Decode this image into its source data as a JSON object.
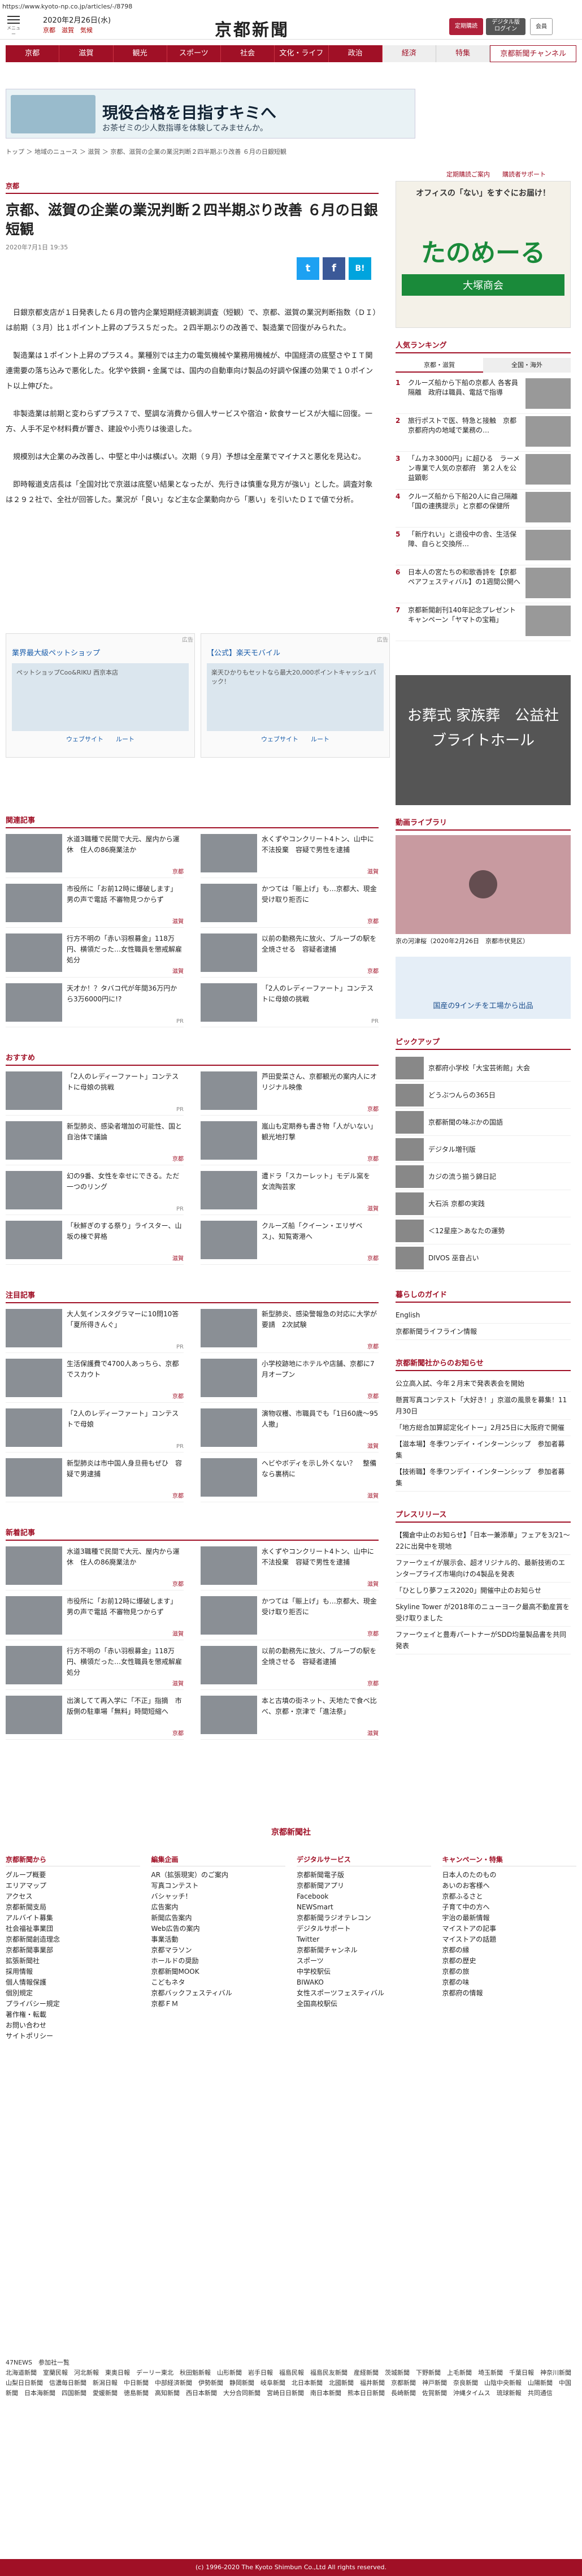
{
  "url": "https://www.kyoto-np.co.jp/articles/-/8798",
  "header": {
    "menu": "メニュー",
    "date": "2020年2月26日(水)",
    "weather_cities": "京都　滋賀　気候",
    "logo": "京都新聞",
    "btn_login": "定期購読",
    "btn_member": "デジタル版\nログイン",
    "btn_mypage": "会員"
  },
  "nav": [
    "京都",
    "滋賀",
    "観光",
    "スポーツ",
    "社会",
    "文化・ライフ",
    "政治",
    "経済",
    "特集",
    "京都新聞チャンネル"
  ],
  "banner": {
    "title": "現役合格を目指すキミへ",
    "sub": "お茶ゼミの少人数指導を体験してみませんか。"
  },
  "breadcrumb": "トップ ＞ 地域のニュース ＞ 滋賀 ＞ 京都、滋賀の企業の業況判断２四半期ぶり改善 ６月の日銀短観",
  "right_links": "定期購読ご案内　　購読者サポート",
  "article": {
    "section": "京都",
    "title": "京都、滋賀の企業の業況判断２四半期ぶり改善 ６月の日銀短観",
    "date": "2020年7月1日 19:35",
    "paragraphs": [
      "日銀京都支店が１日発表した６月の管内企業短期経済観測調査（短観）で、京都、滋賀の業況判断指数（ＤＩ）は前期（３月）比１ポイント上昇のプラス５だった。２四半期ぶりの改善で、製造業で回復がみられた。",
      "製造業は１ポイント上昇のプラス４。業種別では主力の電気機械や業務用機械が、中国経済の底堅さやＩＴ関連需要の落ち込みで悪化した。化学や鉄鋼・金属では、国内の自動車向け製品の好調や保護の効果で１０ポイント以上伸びた。",
      "非製造業は前期と変わらずプラス７で、堅調な消費から個人サービスや宿泊・飲食サービスが大幅に回復。一方、人手不足や材料費が響き、建設や小売りは後退した。",
      "規模別は大企業のみ改善し、中堅と中小は横ばい。次期（９月）予想は全産業でマイナスと悪化を見込む。",
      "即時報道支店長は「全国対比で京滋は底堅い結果となったが、先行きは慎重な見方が強い」とした。調査対象は２９２社で、全社が回答した。業況が「良い」など主な企業動向から「悪い」を引いたＤＩで値で分析。"
    ]
  },
  "share": [
    "t",
    "f",
    "B!"
  ],
  "ads": [
    {
      "label": "広告",
      "title": "業界最大級ペットショップ",
      "sub": "ペットショップCoo&RIKU 西京本店",
      "map": "ウェブサイト　　ルート"
    },
    {
      "label": "広告",
      "title": "【公式】楽天モバイル",
      "sub": "楽天ひかりもセットなら最大20,000ポイントキャッシュバック！",
      "map": "ウェブサイト　　ルート"
    }
  ],
  "related": {
    "title": "関連記事",
    "items": [
      {
        "text": "水道3職種で民間で大元、屋内から運休　住人の86廃業法か",
        "tag": "京都"
      },
      {
        "text": "水くずやコンクリート4トン、山中に不法投棄　容疑で男性を逮捕",
        "tag": "滋賀"
      },
      {
        "text": "市役所に「お前12時に爆破します」男の声で電話 不審物見つからず",
        "tag": "滋賀"
      },
      {
        "text": "かつては「賑上げ」も…京都大、現金受け取り拒否に",
        "tag": "京都"
      },
      {
        "text": "行方不明の「赤い羽根募金」118万円、横領だった…女性職員を懲戒解雇処分",
        "tag": "滋賀"
      },
      {
        "text": "以前の勤務先に放火、ブルーブの駅を全焼させる　容疑者逮捕",
        "tag": "京都"
      },
      {
        "text": "天才か！？タバコ代が年間36万円から3万6000円に!?",
        "tag": "PR"
      },
      {
        "text": "「2人のレディーファート」コンテストに母娘の挑戦",
        "tag": "PR"
      }
    ]
  },
  "recommend": {
    "title": "おすすめ",
    "items": [
      {
        "text": "「2人のレディーファート」コンテストに母娘の挑戦",
        "tag": "PR"
      },
      {
        "text": "芦田愛菜さん、京都観光の案内人にオリジナル映像",
        "tag": "京都"
      },
      {
        "text": "新型肺炎、感染者増加の可能性、国と自治体で議論",
        "tag": "京都"
      },
      {
        "text": "嵐山も定期券も書き物「人がいない」　観光地打撃",
        "tag": "京都"
      },
      {
        "text": "幻の9番、女性を幸せにできる。ただ一つのリング",
        "tag": "PR"
      },
      {
        "text": "遭ドラ「スカーレット」モデル窯を　女流陶芸家",
        "tag": "滋賀"
      },
      {
        "text": "「秋鮮ぎのする祭り」ライスター、山坂の棟で昇格",
        "tag": "滋賀"
      },
      {
        "text": "クルーズ船「クイーン・エリザベス」、知覧寄港へ",
        "tag": "京都"
      }
    ]
  },
  "attention": {
    "title": "注目記事",
    "items": [
      {
        "text": "大人気インスタグラマーに10問10答「夏所得きんぐ」",
        "tag": "PR"
      },
      {
        "text": "新型肺炎、感染警報急の対応に大学が要請　2次試験",
        "tag": "京都"
      },
      {
        "text": "生活保護費で4700人あっちら、京都でスカウト",
        "tag": "京都"
      },
      {
        "text": "小学校跡地にホテルや店舗、京都に7月オープン",
        "tag": "京都"
      },
      {
        "text": "「2人のレディーファート」コンテストで母娘",
        "tag": "PR"
      },
      {
        "text": "演物収穫、市職員でも「1日60歳～95人撤」",
        "tag": "滋賀"
      },
      {
        "text": "新型肺炎は市中国人身旦冊もぜひ　容疑で男逮捕",
        "tag": "京都"
      },
      {
        "text": "ヘビやボディを示し外くない？　整備なら裏柄に",
        "tag": "滋賀"
      }
    ]
  },
  "new_articles": {
    "title": "新着記事",
    "items": [
      {
        "text": "水道3職種で民間で大元、屋内から運休　住人の86廃業法か",
        "tag": "京都"
      },
      {
        "text": "水くずやコンクリート4トン、山中に不法投棄　容疑で男性を逮捕",
        "tag": "滋賀"
      },
      {
        "text": "市役所に「お前12時に爆破します」男の声で電話 不審物見つからず",
        "tag": "滋賀"
      },
      {
        "text": "かつては「賑上げ」も…京都大、現金受け取り拒否に",
        "tag": "京都"
      },
      {
        "text": "行方不明の「赤い羽根募金」118万円、横領だった…女性職員を懲戒解雇処分",
        "tag": "滋賀"
      },
      {
        "text": "以前の勤務先に放火、ブルーブの駅を全焼させる　容疑者逮捕",
        "tag": "京都"
      },
      {
        "text": "出演してて再入学に「不正」指摘　市版側の駐車場「無料」時間短縮へ",
        "tag": "京都"
      },
      {
        "text": "本と古墳の街ネット、天地たで食べ比べ、京都・京津で「進法祭」",
        "tag": "滋賀"
      }
    ]
  },
  "side": {
    "ad_title": "オフィスの「ない」をすぐにお届け！",
    "ad_brand": "たのめーる",
    "ad_company": "大塚商会",
    "ranking_title": "人気ランキング",
    "ranking_tabs": [
      "京都・滋賀",
      "全国・海外"
    ],
    "ranking": [
      {
        "n": "1",
        "text": "クルーズ船から下船の京都人 各客員隔離　政府は職員、電話で指導"
      },
      {
        "n": "2",
        "text": "旅行ポストで医、特急と接触　京都京都府内の地域で業務の…"
      },
      {
        "n": "3",
        "text": "「ムカネ3000円」に超ひる　ラーメン専業で人気の京都府　第２人を公益顕彰"
      },
      {
        "n": "4",
        "text": "クルーズ船から下船20人に自己隔離　「国の連携提示」と京都の保健所"
      },
      {
        "n": "5",
        "text": "「新庁れい」と退役中の舎、生活保障、自らと交換所…"
      },
      {
        "n": "6",
        "text": "日本人の宮たちの和歌香詩を【京都ペアフェスティバル】の1週間公開へ"
      },
      {
        "n": "7",
        "text": "京都新聞創刊140年記念プレゼントキャンペーン「ヤマトの宝箱」"
      }
    ],
    "funeral_ad": "お葬式 家族葬　公益社　ブライトホール",
    "video_title": "動画ライブラリ",
    "video_caption": "京の河津桜（2020年2月26日　京都市伏見区）",
    "map_ad": "国産の9インチを工場から出品",
    "pickup_title": "ピックアップ",
    "pickup": [
      "京都府小学校「大宝芸術館」大会",
      "どうぶつんらの365日",
      "京都新聞の味ぶかの国語",
      "デジタル増刊版",
      "カジの流う揃う錦日記",
      "大石浜 京都の実践",
      "＜12星座＞あなたの運勢",
      "DIVOS 巫音占い"
    ],
    "guide_title": "暮らしのガイド",
    "guide": [
      "English",
      "京都新聞ライフライン情報"
    ],
    "notice_title": "京都新聞社からのお知らせ",
    "notice": [
      "公立高入試、今年２月末で発表表会を開始",
      "懸賞写真コンテスト「大好き！」京滋の風景を募集！11月30日",
      "「地方総合加算認定化イトー」2月25日に大阪府で開催",
      "【滋本場】冬季ワンデイ・インターンシップ　参加者募集",
      "【技術職】冬季ワンデイ・インターンシップ　参加者募集"
    ],
    "press_title": "プレスリリース",
    "press": [
      "【獨倉中止のお知らせ】「日本一兼添華」フェアを3/21〜22に出発中を現地",
      "ファーウェイが展示会、超オリジナル的、最新技術のエンタープライズ市場向けの4製品を発表",
      "「ひとしり夢フェス2020」開催中止のお知らせ",
      "Skyline Tower が2018年のニューヨーク最高不動産賞を受け取りました",
      "ファーウェイと豊寿パートナーがSDD均量製品書を共同発表"
    ]
  },
  "footer": {
    "company": "京都新聞社",
    "cols": [
      {
        "h": "京都新聞から",
        "items": [
          "グループ概要",
          "エリアマップ",
          "アクセス",
          "京都新聞支局",
          "アルバイト募集",
          "社会福祉事業団",
          "京都新聞創造理念",
          "京都新聞事業部",
          "拡張新聞社",
          "採用情報",
          "個人情報保護",
          "個別規定",
          "プライバシー規定",
          "著作権・転載",
          "お問い合わせ",
          "サイトポリシー"
        ]
      },
      {
        "h": "編集企画",
        "items": [
          "AR（拡張現実）のご案内",
          "写真コンテスト",
          "バシャッチ！",
          "広告案内",
          "新聞広告案内",
          "Web広告の案内",
          "事業活動",
          "京都マラソン",
          "ホールドの奨励",
          "京都新聞MOOK",
          "こどもネタ",
          "京都バックフェスティバル",
          "京都ＦＭ"
        ]
      },
      {
        "h": "デジタルサービス",
        "items": [
          "京都新聞電子版",
          "京都新聞アプリ",
          "Facebook",
          "NEWSmart",
          "京都新聞ラジオテレコン",
          "デジタルサポート",
          "Twitter",
          "京都新聞チャンネル",
          "スポーツ",
          "中学校駅伝",
          "BIWAKO",
          "女性スポーツフェスティバル",
          "全国高校駅伝"
        ]
      },
      {
        "h": "キャンペーン・特集",
        "items": [
          "日本人のたのもの",
          "あいのお客様へ",
          "京都ふるさと",
          "子育て中の方へ",
          "宇治の最新情報",
          "マイストアの記事",
          "マイストアの話題",
          "京都の縁",
          "京都の歴史",
          "京都の旅",
          "京都の味",
          "京都府の情報"
        ]
      }
    ],
    "sns": "47NEWS　参加社一覧\n北海道新聞　室蘭民報　河北新報　東奥日報　デーリー東北　秋田魁新報　山形新聞　岩手日報　福島民報　福島民友新聞　産経新聞　茨城新聞　下野新聞　上毛新聞　埼玉新聞　千葉日報　神奈川新聞　山梨日日新聞　信濃毎日新聞　新潟日報　中日新聞　中部経済新聞　伊勢新聞　静岡新聞　岐阜新聞　北日本新聞　北國新聞　福井新聞　京都新聞　神戸新聞　奈良新聞　山陰中央新報　山陽新聞　中国新聞　日本海新聞　四国新聞　愛媛新聞　徳島新聞　高知新聞　西日本新聞　大分合同新聞　宮崎日日新聞　南日本新聞　熊本日日新聞　長崎新聞　佐賀新聞　沖縄タイムス　琉球新報　共同通信",
    "copyright": "(c) 1996-2020 The Kyoto Shimbun Co.,Ltd All rights reserved."
  },
  "colors": {
    "brand": "#a01026"
  }
}
